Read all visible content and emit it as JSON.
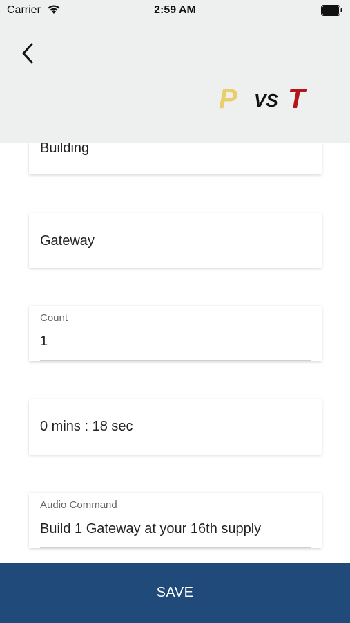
{
  "status_bar": {
    "carrier": "Carrier",
    "time": "2:59 AM"
  },
  "header": {
    "back_icon": "chevron-left-icon",
    "logo": {
      "p": "P",
      "vs": "VS",
      "t": "T",
      "colors": {
        "p": "#e8cf6a",
        "vs": "#111111",
        "t": "#b3151a"
      }
    },
    "background": "#eeefef"
  },
  "form": {
    "building": {
      "value": "Building"
    },
    "gateway": {
      "value": "Gateway"
    },
    "count": {
      "label": "Count",
      "value": "1"
    },
    "time": {
      "value": "0 mins : 18 sec"
    },
    "audio_command": {
      "label": "Audio Command",
      "value": "Build 1 Gateway at your 16th supply"
    }
  },
  "save_button": {
    "label": "SAVE",
    "color": "#1f4a7a"
  }
}
